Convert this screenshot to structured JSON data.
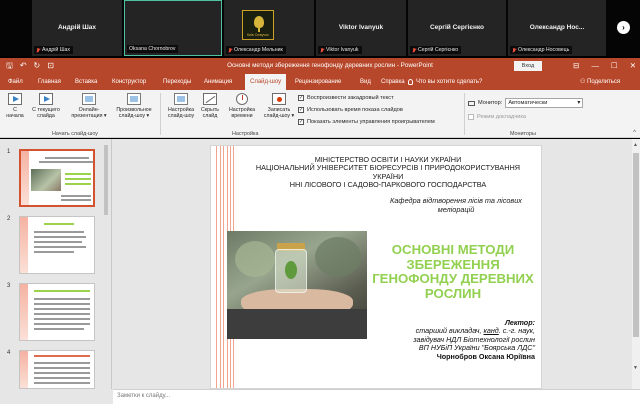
{
  "call": {
    "participants": [
      {
        "name": "Андрій Шах",
        "caption": "Андрій Шах"
      },
      {
        "name": "",
        "caption": "Oksana Chornobrov"
      },
      {
        "name": "",
        "caption": "Олександр Мельник",
        "logo_text": "Київ Співучих"
      },
      {
        "name": "Viktor Ivanyuk",
        "caption": "Viktor Ivanyuk"
      },
      {
        "name": "Сергій Сергієнко",
        "caption": "Сергій Сергієнко"
      },
      {
        "name": "Олександр Нос...",
        "caption": "Олександр Носовець"
      }
    ],
    "next_icon": "›"
  },
  "titlebar": {
    "qat_save": "🖫",
    "qat_undo": "↶",
    "qat_redo": "↻",
    "qat_start": "⊡",
    "document_title": "Основні методи збереження генофонду деревних рослин  -  PowerPoint",
    "signin": "Вход",
    "ribbon_display": "⊟",
    "minimize": "—",
    "maximize": "☐",
    "close": "✕"
  },
  "tabs": [
    {
      "label": "Файл"
    },
    {
      "label": "Главная"
    },
    {
      "label": "Вставка"
    },
    {
      "label": "Конструктор"
    },
    {
      "label": "Переходы"
    },
    {
      "label": "Анимация"
    },
    {
      "label": "Слайд-шоу"
    },
    {
      "label": "Рецензирование"
    },
    {
      "label": "Вид"
    },
    {
      "label": "Справка"
    }
  ],
  "tell_me": "Что вы хотите сделать?",
  "share": "⚇ Поделиться",
  "ribbon": {
    "from_beginning": "С\nначала",
    "from_current": "С текущего\nслайда",
    "online": "Онлайн-\nпрезентация ▾",
    "custom": "Произвольное\nслайд-шоу ▾",
    "group_start": "Начать слайд-шоу",
    "setup": "Настройка\nслайд-шоу",
    "hide": "Скрыть\nслайд",
    "rehearse": "Настройка\nвремени",
    "record": "Записать\nслайд-шоу ▾",
    "group_setup": "Настройка",
    "chk_narration": "Воспроизвести закадровый текст",
    "chk_timings": "Использовать время показа слайдов",
    "chk_media": "Показать элементы управления проигрывателем",
    "monitor_label": "Монитор:",
    "monitor_value": "Автоматически",
    "presenter": "Режим докладчика",
    "group_monitors": "Мониторы",
    "collapse": "^"
  },
  "thumbs": [
    {
      "num": "1"
    },
    {
      "num": "2"
    },
    {
      "num": "3"
    },
    {
      "num": "4"
    }
  ],
  "slide": {
    "org_1": "МІНІСТЕРСТВО ОСВІТИ І НАУКИ УКРАЇНИ",
    "org_2": "НАЦІОНАЛЬНИЙ УНІВЕРСИТЕТ БІОРЕСУРСІВ І ПРИРОДОКОРИСТУВАННЯ УКРАЇНИ",
    "org_3": "ННІ ЛІСОВОГО І САДОВО-ПАРКОВОГО ГОСПОДАРСТВА",
    "dept": "Кафедра відтворення лісів та лісових меліорацій",
    "title": "ОСНОВНІ МЕТОДИ ЗБЕРЕЖЕННЯ ГЕНОФОНДУ ДЕРЕВНИХ РОСЛИН",
    "lecturer_label": "Лектор:",
    "lecturer_l1_a": "старший викладач, ",
    "lecturer_l1_b": "канд",
    "lecturer_l1_c": ". с.-г. наук,",
    "lecturer_l2": "завідувач НДЛ Біотехнології рослин",
    "lecturer_l3": "ВП НУБіП України \"Боярська ЛДС\"",
    "lecturer_name": "Чорнобров Оксана Юріївна"
  },
  "notes_placeholder": "Заметки к слайду...",
  "colors": {
    "accent": "#b7472a",
    "title_green": "#92d050",
    "thumb_selected": "#d35230"
  }
}
